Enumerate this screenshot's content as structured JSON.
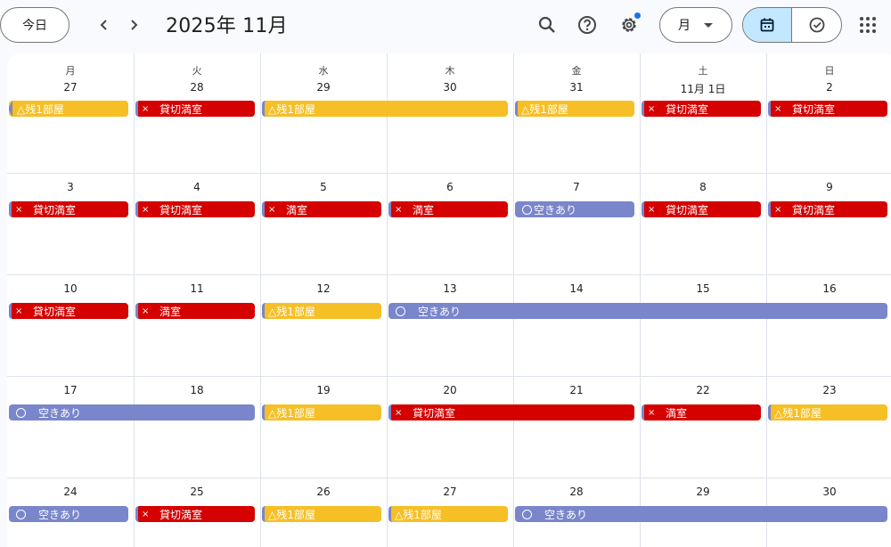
{
  "header": {
    "today_label": "今日",
    "title": "2025年 11月",
    "view_label": "月"
  },
  "weekdays": [
    "月",
    "火",
    "水",
    "木",
    "金",
    "土",
    "日"
  ],
  "weeks": [
    [
      "27",
      "28",
      "29",
      "30",
      "31",
      "11月 1日",
      "2"
    ],
    [
      "3",
      "4",
      "5",
      "6",
      "7",
      "8",
      "9"
    ],
    [
      "10",
      "11",
      "12",
      "13",
      "14",
      "15",
      "16"
    ],
    [
      "17",
      "18",
      "19",
      "20",
      "21",
      "22",
      "23"
    ],
    [
      "24",
      "25",
      "26",
      "27",
      "28",
      "29",
      "30"
    ]
  ],
  "events": [
    {
      "week": 0,
      "col": 0,
      "span": 1,
      "type": "yellow",
      "prefix": "",
      "text": "△残1部屋",
      "cont_left": true
    },
    {
      "week": 0,
      "col": 1,
      "span": 1,
      "type": "red",
      "prefix": "×",
      "text": "貸切満室"
    },
    {
      "week": 0,
      "col": 2,
      "span": 2,
      "type": "yellow",
      "prefix": "",
      "text": "△残1部屋"
    },
    {
      "week": 0,
      "col": 4,
      "span": 1,
      "type": "yellow",
      "prefix": "",
      "text": "△残1部屋"
    },
    {
      "week": 0,
      "col": 5,
      "span": 1,
      "type": "red",
      "prefix": "×",
      "text": "貸切満室"
    },
    {
      "week": 0,
      "col": 6,
      "span": 1,
      "type": "red",
      "prefix": "×",
      "text": "貸切満室"
    },
    {
      "week": 1,
      "col": 0,
      "span": 1,
      "type": "red",
      "prefix": "×",
      "text": "貸切満室"
    },
    {
      "week": 1,
      "col": 1,
      "span": 1,
      "type": "red",
      "prefix": "×",
      "text": "貸切満室"
    },
    {
      "week": 1,
      "col": 2,
      "span": 1,
      "type": "red",
      "prefix": "×",
      "text": "満室"
    },
    {
      "week": 1,
      "col": 3,
      "span": 1,
      "type": "red",
      "prefix": "×",
      "text": "満室"
    },
    {
      "week": 1,
      "col": 4,
      "span": 1,
      "type": "blue",
      "prefix": "circle-tight",
      "text": "空きあり"
    },
    {
      "week": 1,
      "col": 5,
      "span": 1,
      "type": "red",
      "prefix": "×",
      "text": "貸切満室"
    },
    {
      "week": 1,
      "col": 6,
      "span": 1,
      "type": "red",
      "prefix": "×",
      "text": "貸切満室"
    },
    {
      "week": 2,
      "col": 0,
      "span": 1,
      "type": "red",
      "prefix": "×",
      "text": "貸切満室"
    },
    {
      "week": 2,
      "col": 1,
      "span": 1,
      "type": "red",
      "prefix": "×",
      "text": "満室"
    },
    {
      "week": 2,
      "col": 2,
      "span": 1,
      "type": "yellow",
      "prefix": "",
      "text": "△残1部屋"
    },
    {
      "week": 2,
      "col": 3,
      "span": 4,
      "type": "blue",
      "prefix": "circle",
      "text": "空きあり"
    },
    {
      "week": 3,
      "col": 0,
      "span": 2,
      "type": "blue",
      "prefix": "circle",
      "text": "空きあり"
    },
    {
      "week": 3,
      "col": 2,
      "span": 1,
      "type": "yellow",
      "prefix": "",
      "text": "△残1部屋"
    },
    {
      "week": 3,
      "col": 3,
      "span": 2,
      "type": "red",
      "prefix": "×",
      "text": "貸切満室"
    },
    {
      "week": 3,
      "col": 5,
      "span": 1,
      "type": "red",
      "prefix": "×",
      "text": "満室"
    },
    {
      "week": 3,
      "col": 6,
      "span": 1,
      "type": "yellow",
      "prefix": "",
      "text": "△残1部屋"
    },
    {
      "week": 4,
      "col": 0,
      "span": 1,
      "type": "blue",
      "prefix": "circle",
      "text": "空きあり"
    },
    {
      "week": 4,
      "col": 1,
      "span": 1,
      "type": "red",
      "prefix": "×",
      "text": "貸切満室"
    },
    {
      "week": 4,
      "col": 2,
      "span": 1,
      "type": "yellow",
      "prefix": "",
      "text": "△残1部屋"
    },
    {
      "week": 4,
      "col": 3,
      "span": 1,
      "type": "yellow",
      "prefix": "",
      "text": "△残1部屋"
    },
    {
      "week": 4,
      "col": 4,
      "span": 3,
      "type": "blue",
      "prefix": "circle",
      "text": "空きあり"
    }
  ],
  "colors": {
    "red": "#d50000",
    "yellow": "#f6bf26",
    "blue": "#7986cb",
    "accent": "#1a73e8",
    "selected": "#c2e7ff"
  }
}
